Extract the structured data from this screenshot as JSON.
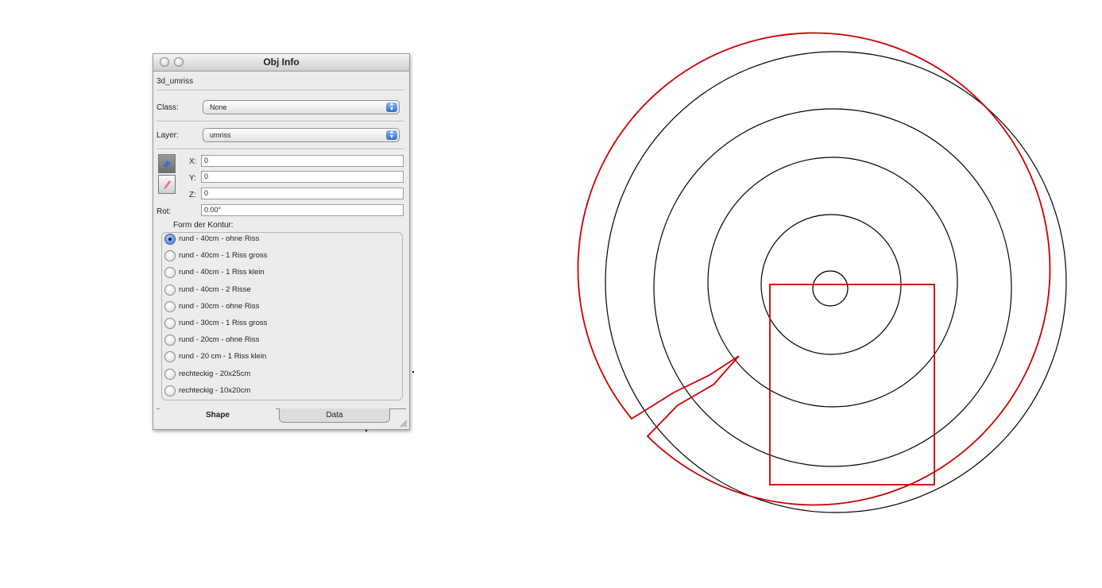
{
  "palette": {
    "title": "Obj Info",
    "object_name": "3d_umriss",
    "class_label": "Class:",
    "class_value": "None",
    "layer_label": "Layer:",
    "layer_value": "umriss",
    "x_label": "X:",
    "x_value": "0",
    "y_label": "Y:",
    "y_value": "0",
    "z_label": "Z:",
    "z_value": "0",
    "rot_label": "Rot:",
    "rot_value": "0.00°",
    "form_group_title": "Form der Kontur:",
    "options": [
      {
        "label": "rund - 40cm - ohne Riss",
        "selected": true
      },
      {
        "label": "rund - 40cm - 1 Riss gross",
        "selected": false
      },
      {
        "label": "rund - 40cm - 1 Riss klein",
        "selected": false
      },
      {
        "label": "rund - 40cm - 2 Risse",
        "selected": false
      },
      {
        "label": "rund - 30cm - ohne Riss",
        "selected": false
      },
      {
        "label": "rund - 30cm - 1 Riss gross",
        "selected": false
      },
      {
        "label": "rund - 20cm - ohne Riss",
        "selected": false
      },
      {
        "label": "rund - 20 cm - 1 Riss klein",
        "selected": false
      },
      {
        "label": "rechteckig - 20x25cm",
        "selected": false
      },
      {
        "label": "rechteckig - 10x20cm",
        "selected": false
      }
    ],
    "tabs": {
      "shape": "Shape",
      "data": "Data"
    }
  },
  "colors": {
    "outline_red": "#cc0000",
    "circle_black": "#000000",
    "selection_blue": "#3a7cd6"
  }
}
